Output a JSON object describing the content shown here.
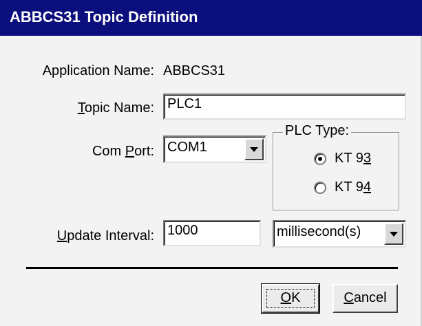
{
  "window": {
    "title": "ABBCS31 Topic Definition"
  },
  "form": {
    "application_name": {
      "label": "Application Name:",
      "value": "ABBCS31"
    },
    "topic_name": {
      "label_prefix": "",
      "label_mnemonic": "T",
      "label_rest": "opic Name:",
      "value": "PLC1"
    },
    "com_port": {
      "label_prefix": "Com ",
      "label_mnemonic": "P",
      "label_rest": "ort:",
      "value": "COM1"
    },
    "update_interval": {
      "label_prefix": "",
      "label_mnemonic": "U",
      "label_rest": "pdate Interval:",
      "value": "1000",
      "unit": "millisecond(s)"
    }
  },
  "plc_type": {
    "legend": "PLC Type:",
    "options": [
      {
        "prefix": "KT 9",
        "mnemonic": "3",
        "selected": true
      },
      {
        "prefix": "KT 9",
        "mnemonic": "4",
        "selected": false
      }
    ]
  },
  "buttons": {
    "ok": {
      "mnemonic": "O",
      "rest": "K"
    },
    "cancel": {
      "mnemonic": "C",
      "rest": "ancel"
    }
  },
  "colors": {
    "titlebar": "#0b0e7d",
    "dialog_bg": "#f3f3f3"
  }
}
